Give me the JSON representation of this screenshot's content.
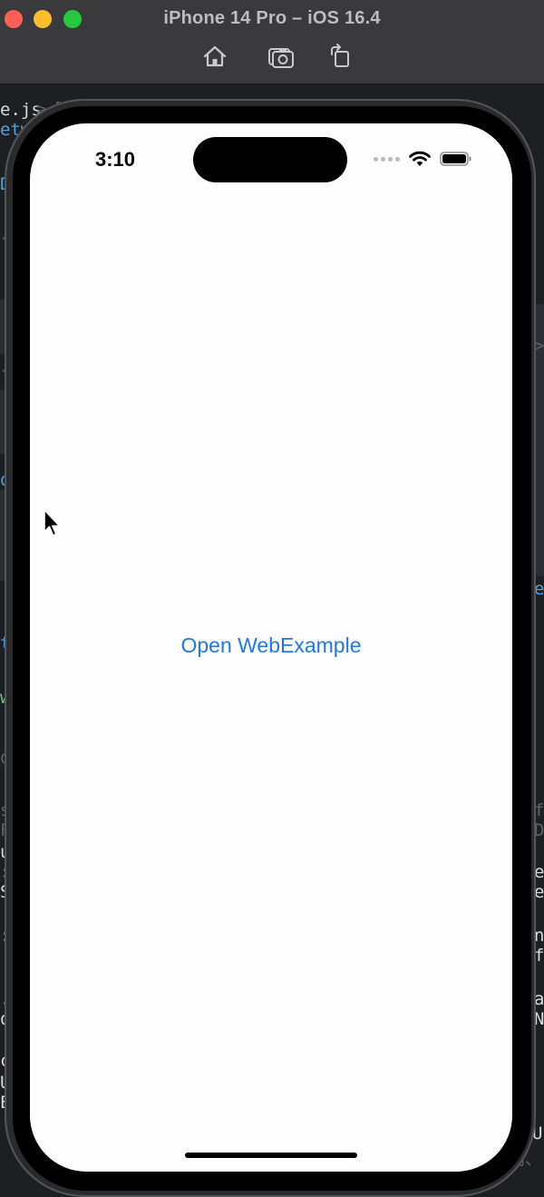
{
  "simulator": {
    "title": "iPhone 14 Pro – iOS 16.4",
    "buttons": [
      {
        "name": "home",
        "icon": "home-icon"
      },
      {
        "name": "screenshot",
        "icon": "camera-icon"
      },
      {
        "name": "rotate",
        "icon": "rotate-icon"
      }
    ],
    "window_controls": {
      "close": "#ff5f57",
      "minimize": "#febc2e",
      "zoom": "#28c840"
    }
  },
  "background_editor": {
    "fragments": [
      {
        "text": "e.js",
        "style": "bright"
      },
      {
        "text": ">",
        "style": "dim"
      },
      {
        "text": "[",
        "style": "dim"
      },
      {
        "text": "etwo",
        "style": "blue"
      },
      {
        "text": "D",
        "style": "blue"
      },
      {
        "text": "‹",
        "style": "dim"
      },
      {
        "text": "‹",
        "style": "dim"
      },
      {
        "text": "o",
        "style": "blue"
      },
      {
        "text": "t",
        "style": "blue"
      },
      {
        "text": "w",
        "style": "green"
      },
      {
        "text": "o",
        "style": "dim"
      },
      {
        "text": "s",
        "style": "dim"
      },
      {
        "text": "F",
        "style": "dim"
      },
      {
        "text": "u",
        "style": "bright"
      },
      {
        "text": ":",
        "style": "bright"
      },
      {
        "text": "S",
        "style": "bright"
      },
      {
        "text": ":",
        "style": "bright"
      },
      {
        "text": ".",
        "style": "bright"
      },
      {
        "text": "o",
        "style": "bright"
      },
      {
        "text": "c",
        "style": "bright"
      },
      {
        "text": "U",
        "style": "bright"
      },
      {
        "text": "E",
        "style": "bright"
      },
      {
        "text": ">",
        "style": "dim"
      },
      {
        "text": "e",
        "style": "blue"
      },
      {
        "text": "f",
        "style": "dim"
      },
      {
        "text": "D",
        "style": "dim"
      },
      {
        "text": "e",
        "style": "bright"
      },
      {
        "text": "e",
        "style": "bright"
      },
      {
        "text": "n",
        "style": "bright"
      },
      {
        "text": "f",
        "style": "bright"
      },
      {
        "text": "a",
        "style": "bright"
      },
      {
        "text": "N",
        "style": "bright"
      },
      {
        "text": "U",
        "style": "bright"
      },
      {
        "text": "沏、",
        "style": "dim"
      }
    ]
  },
  "status_bar": {
    "time": "3:10",
    "icons": [
      "signal-dots",
      "wifi-icon",
      "battery-icon"
    ]
  },
  "app": {
    "link_label": "Open WebExample",
    "accent_color": "#2279d6",
    "background_color": "#fdfcfe"
  }
}
